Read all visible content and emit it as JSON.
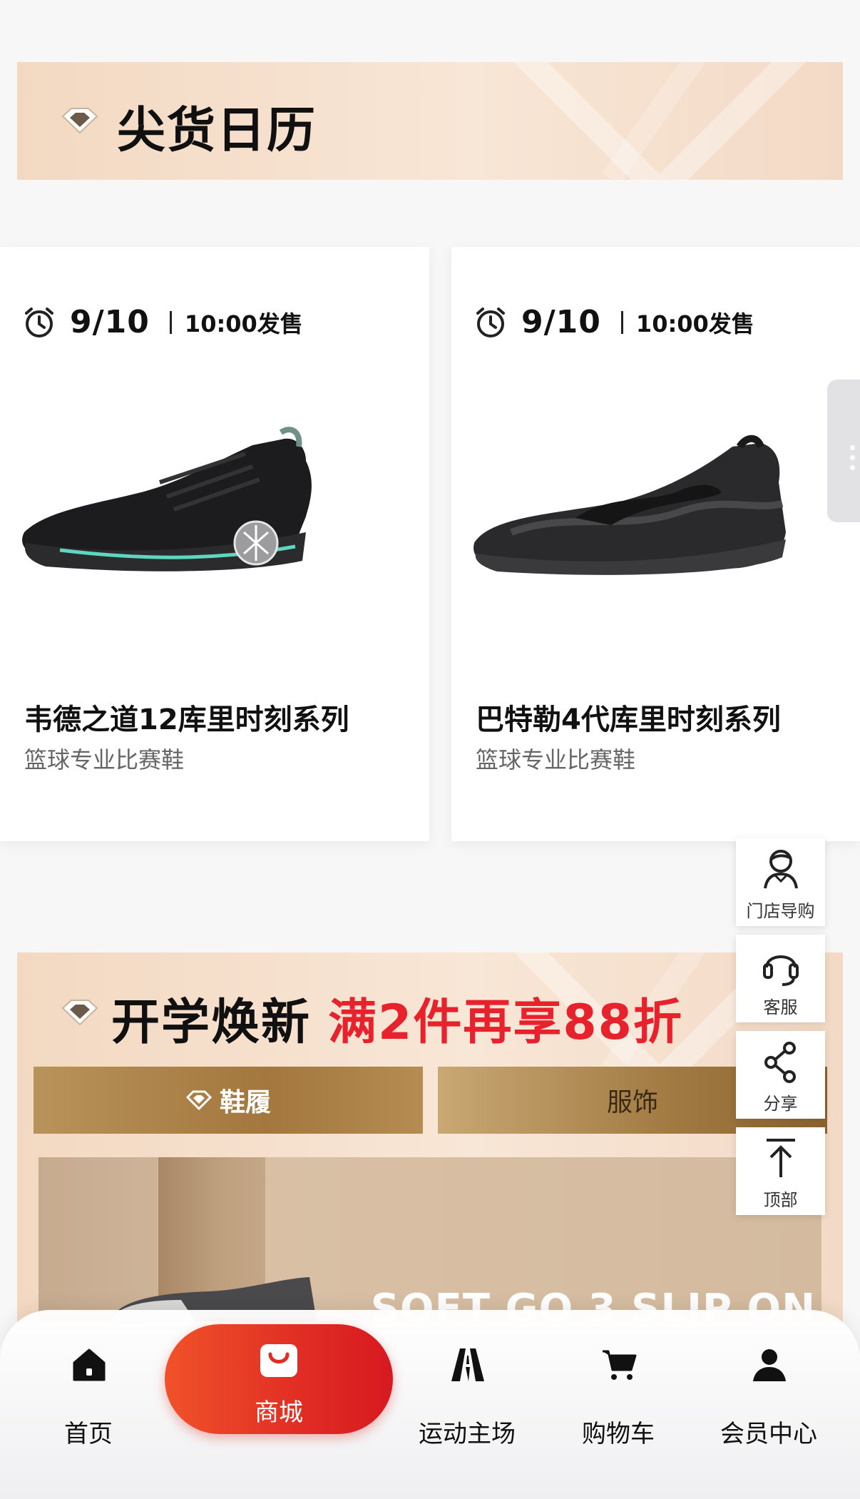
{
  "section1": {
    "title": "尖货日历"
  },
  "calendar": [
    {
      "date": "9/10",
      "time": "10:00发售",
      "name": "韦德之道12库里时刻系列",
      "subtitle": "篮球专业比赛鞋",
      "icon": "basketball-shoe-black-teal"
    },
    {
      "date": "9/10",
      "time": "10:00发售",
      "name": "巴特勒4代库里时刻系列",
      "subtitle": "篮球专业比赛鞋",
      "icon": "basketball-shoe-black-carbon"
    }
  ],
  "floating": [
    {
      "label": "门店导购",
      "icon": "shop-guide-icon"
    },
    {
      "label": "客服",
      "icon": "headset-icon"
    },
    {
      "label": "分享",
      "icon": "share-icon"
    },
    {
      "label": "顶部",
      "icon": "back-to-top-icon"
    }
  ],
  "section2": {
    "title": "开学焕新",
    "promo": "满2件再享88折",
    "tabs": [
      {
        "label": "鞋履",
        "active": true
      },
      {
        "label": "服饰",
        "active": false
      }
    ],
    "banner_text": "SOFT GO 3 SLIP ON"
  },
  "nav": [
    {
      "label": "首页",
      "icon": "home-icon",
      "active": false
    },
    {
      "label": "商城",
      "icon": "shopping-bag-icon",
      "active": true
    },
    {
      "label": "运动主场",
      "icon": "track-icon",
      "active": false
    },
    {
      "label": "购物车",
      "icon": "cart-icon",
      "active": false
    },
    {
      "label": "会员中心",
      "icon": "user-icon",
      "active": false
    }
  ],
  "colors": {
    "accent": "#e12d24",
    "promo": "#e8222d",
    "gold": "#a3773e",
    "banner_bg": "#f3d9c2"
  }
}
